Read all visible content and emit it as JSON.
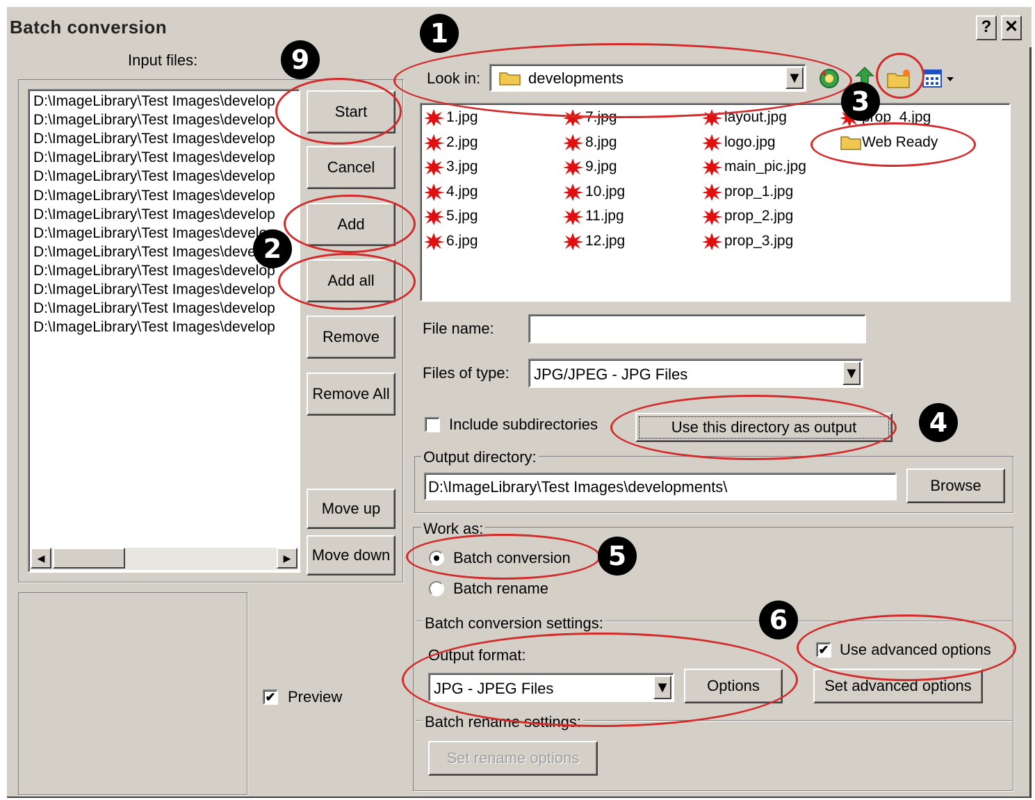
{
  "window": {
    "title": "Batch conversion",
    "help_label": "?",
    "close_label": "✕"
  },
  "left": {
    "input_files_label": "Input files:",
    "files": [
      "D:\\ImageLibrary\\Test Images\\develop",
      "D:\\ImageLibrary\\Test Images\\develop",
      "D:\\ImageLibrary\\Test Images\\develop",
      "D:\\ImageLibrary\\Test Images\\develop",
      "D:\\ImageLibrary\\Test Images\\develop",
      "D:\\ImageLibrary\\Test Images\\develop",
      "D:\\ImageLibrary\\Test Images\\develop",
      "D:\\ImageLibrary\\Test Images\\develop",
      "D:\\ImageLibrary\\Test Images\\develop",
      "D:\\ImageLibrary\\Test Images\\develop",
      "D:\\ImageLibrary\\Test Images\\develop",
      "D:\\ImageLibrary\\Test Images\\develop",
      "D:\\ImageLibrary\\Test Images\\develop"
    ],
    "buttons": {
      "start": "Start",
      "cancel": "Cancel",
      "add": "Add",
      "add_all": "Add all",
      "remove": "Remove",
      "remove_all": "Remove All",
      "move_up": "Move up",
      "move_down": "Move down"
    },
    "preview_label": "Preview",
    "preview_checked": true
  },
  "browser": {
    "look_in_label": "Look in:",
    "look_in_value": "developments",
    "files": [
      {
        "name": "1.jpg",
        "type": "jpg"
      },
      {
        "name": "2.jpg",
        "type": "jpg"
      },
      {
        "name": "3.jpg",
        "type": "jpg"
      },
      {
        "name": "4.jpg",
        "type": "jpg"
      },
      {
        "name": "5.jpg",
        "type": "jpg"
      },
      {
        "name": "6.jpg",
        "type": "jpg"
      },
      {
        "name": "7.jpg",
        "type": "jpg"
      },
      {
        "name": "8.jpg",
        "type": "jpg"
      },
      {
        "name": "9.jpg",
        "type": "jpg"
      },
      {
        "name": "10.jpg",
        "type": "jpg"
      },
      {
        "name": "11.jpg",
        "type": "jpg"
      },
      {
        "name": "12.jpg",
        "type": "jpg"
      },
      {
        "name": "layout.jpg",
        "type": "jpg"
      },
      {
        "name": "logo.jpg",
        "type": "jpg"
      },
      {
        "name": "main_pic.jpg",
        "type": "jpg"
      },
      {
        "name": "prop_1.jpg",
        "type": "jpg"
      },
      {
        "name": "prop_2.jpg",
        "type": "jpg"
      },
      {
        "name": "prop_3.jpg",
        "type": "jpg"
      },
      {
        "name": "prop_4.jpg",
        "type": "jpg"
      },
      {
        "name": "Web Ready",
        "type": "folder"
      }
    ],
    "file_name_label": "File name:",
    "file_name_value": "",
    "files_of_type_label": "Files of type:",
    "files_of_type_value": "JPG/JPEG - JPG Files",
    "include_subdirs_label": "Include subdirectories",
    "include_subdirs_checked": false,
    "use_dir_button": "Use this directory as output"
  },
  "output": {
    "label": "Output directory:",
    "value": "D:\\ImageLibrary\\Test Images\\developments\\",
    "browse": "Browse"
  },
  "work_as": {
    "label": "Work as:",
    "options": [
      "Batch conversion",
      "Batch rename"
    ],
    "selected": "Batch conversion"
  },
  "conversion": {
    "label": "Batch conversion settings:",
    "output_format_label": "Output format:",
    "output_format_value": "JPG - JPEG Files",
    "options_button": "Options",
    "use_advanced_label": "Use advanced options",
    "use_advanced_checked": true,
    "set_advanced_button": "Set advanced options"
  },
  "rename": {
    "label": "Batch rename settings:",
    "set_rename_button": "Set rename options"
  },
  "annotations": [
    "1",
    "2",
    "3",
    "4",
    "5",
    "6",
    "9"
  ],
  "colors": {
    "annotation_ring": "#d42a2a",
    "dialog_bg": "#d4d0c8",
    "jpg_icon": "#e01010",
    "folder": "#f0c850"
  }
}
